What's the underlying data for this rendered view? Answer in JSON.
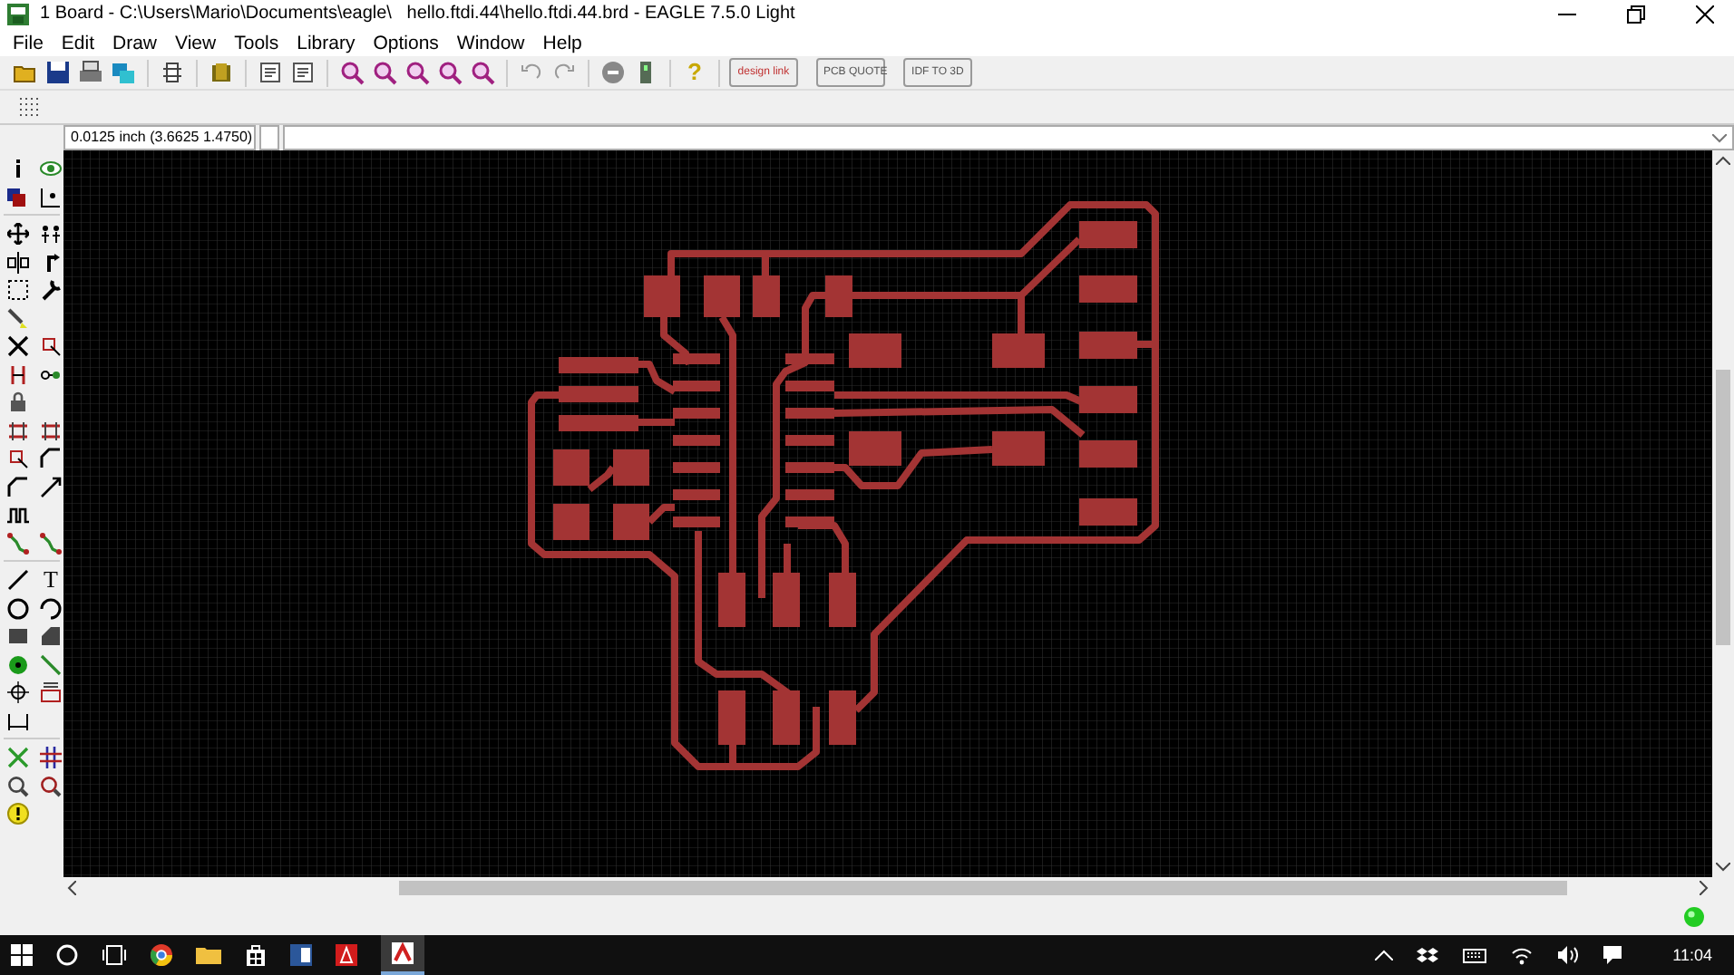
{
  "window": {
    "title": "1 Board - C:\\Users\\Mario\\Documents\\eagle\\   hello.ftdi.44\\hello.ftdi.44.brd - EAGLE 7.5.0 Light"
  },
  "menu": [
    "File",
    "Edit",
    "Draw",
    "View",
    "Tools",
    "Library",
    "Options",
    "Window",
    "Help"
  ],
  "toolbar": {
    "help": "?",
    "promo_buttons": [
      {
        "kind": "design",
        "label": "design link"
      },
      {
        "kind": "quote",
        "label": "PCB QUOTE"
      },
      {
        "kind": "idf",
        "label": "IDF TO 3D"
      }
    ]
  },
  "command_line": {
    "grid_readout": "0.0125 inch (3.6625 1.4750)"
  },
  "toolbox": {
    "text_tool": "T"
  },
  "taskbar": {
    "clock": "11:04"
  }
}
